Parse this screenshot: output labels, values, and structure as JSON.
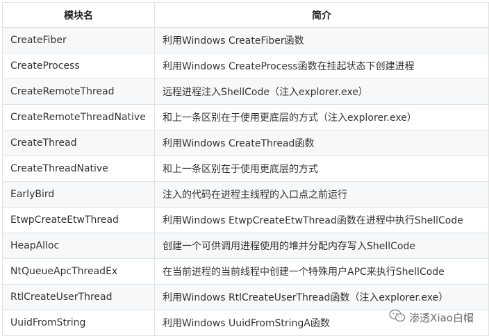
{
  "table": {
    "headers": [
      "模块名",
      "简介"
    ],
    "rows": [
      [
        "CreateFiber",
        "利用Windows CreateFiber函数"
      ],
      [
        "CreateProcess",
        "利用Windows CreateProcess函数在挂起状态下创建进程"
      ],
      [
        "CreateRemoteThread",
        "远程进程注入ShellCode（注入explorer.exe）"
      ],
      [
        "CreateRemoteThreadNative",
        "和上一条区别在于使用更底层的方式（注入explorer.exe）"
      ],
      [
        "CreateThread",
        "利用Windows CreateThread函数"
      ],
      [
        "CreateThreadNative",
        "和上一条区别在于使用更底层的方式"
      ],
      [
        "EarlyBird",
        "注入的代码在进程主线程的入口点之前运行"
      ],
      [
        "EtwpCreateEtwThread",
        "利用Windows EtwpCreateEtwThread函数在进程中执行ShellCode"
      ],
      [
        "HeapAlloc",
        "创建一个可供调用进程使用的堆并分配内存写入ShellCode"
      ],
      [
        "NtQueueApcThreadEx",
        "在当前进程的当前线程中创建一个特殊用户APC来执行ShellCode"
      ],
      [
        "RtlCreateUserThread",
        "利用Windows RtlCreateUserThread函数（注入explorer.exe）"
      ],
      [
        "UuidFromString",
        "利用Windows UuidFromStringA函数"
      ]
    ]
  },
  "watermark": {
    "text": "渗透Xiao白帽",
    "icon": "wechat-icon"
  }
}
